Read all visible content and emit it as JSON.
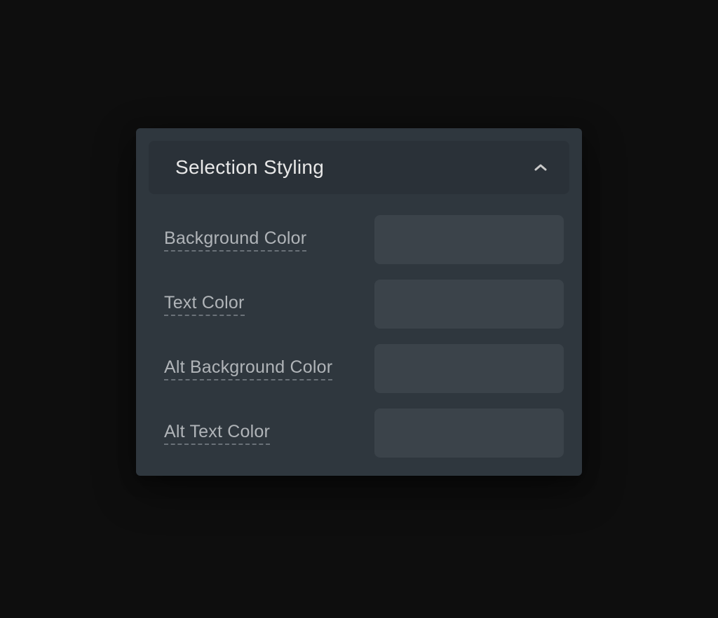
{
  "panel": {
    "title": "Selection Styling",
    "expanded": true,
    "fields": [
      {
        "label": "Background Color",
        "value": ""
      },
      {
        "label": "Text Color",
        "value": ""
      },
      {
        "label": "Alt Background Color",
        "value": ""
      },
      {
        "label": "Alt Text Color",
        "value": ""
      }
    ]
  },
  "colors": {
    "page_bg": "#0e0e0e",
    "panel_bg": "#2f373e",
    "header_bg": "#2a3138",
    "input_bg": "#3b434a",
    "text_primary": "#e8e8e8",
    "text_secondary": "#b0b4b8",
    "dashed_underline": "#6a7178"
  }
}
